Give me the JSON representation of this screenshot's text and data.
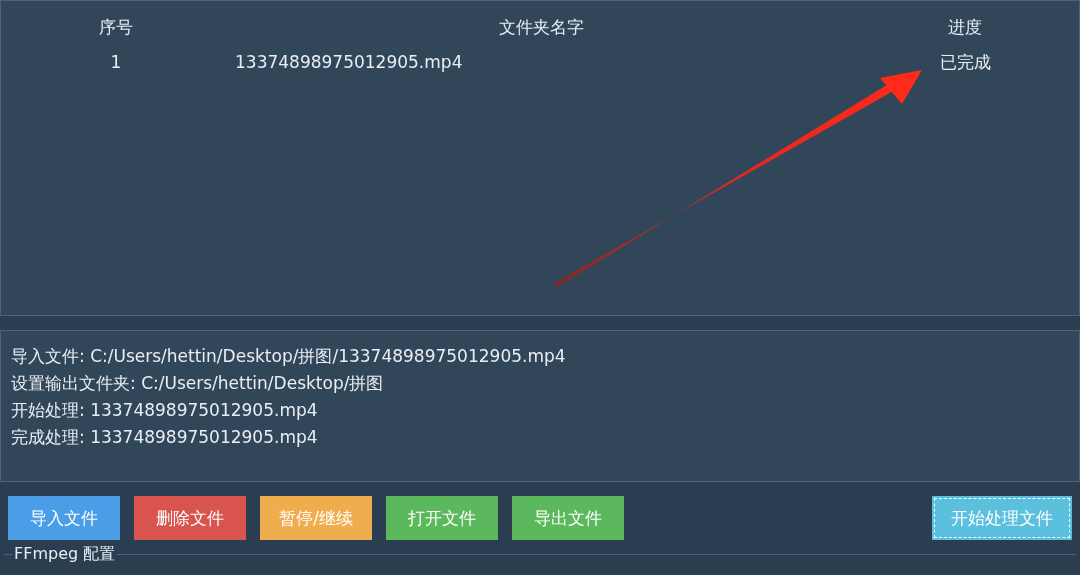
{
  "table": {
    "columns": [
      "序号",
      "文件夹名字",
      "进度"
    ],
    "rows": [
      {
        "cells": [
          "1",
          "13374898975012905.mp4",
          "已完成"
        ]
      }
    ]
  },
  "log": [
    "导入文件: C:/Users/hettin/Desktop/拼图/13374898975012905.mp4",
    "设置输出文件夹: C:/Users/hettin/Desktop/拼图",
    "开始处理: 13374898975012905.mp4",
    "完成处理: 13374898975012905.mp4"
  ],
  "buttons": [
    {
      "label": "导入文件",
      "color": "#4a9de6",
      "focused": false
    },
    {
      "label": "删除文件",
      "color": "#d9534f",
      "focused": false
    },
    {
      "label": "暂停/继续",
      "color": "#f0ad4e",
      "focused": false
    },
    {
      "label": "打开文件",
      "color": "#5cb85c",
      "focused": false
    },
    {
      "label": "导出文件",
      "color": "#5cb85c",
      "focused": false
    }
  ],
  "start_button": {
    "label": "开始处理文件",
    "color": "#5bc0de",
    "focused": true
  },
  "group": {
    "title": "FFmpeg 配置"
  }
}
